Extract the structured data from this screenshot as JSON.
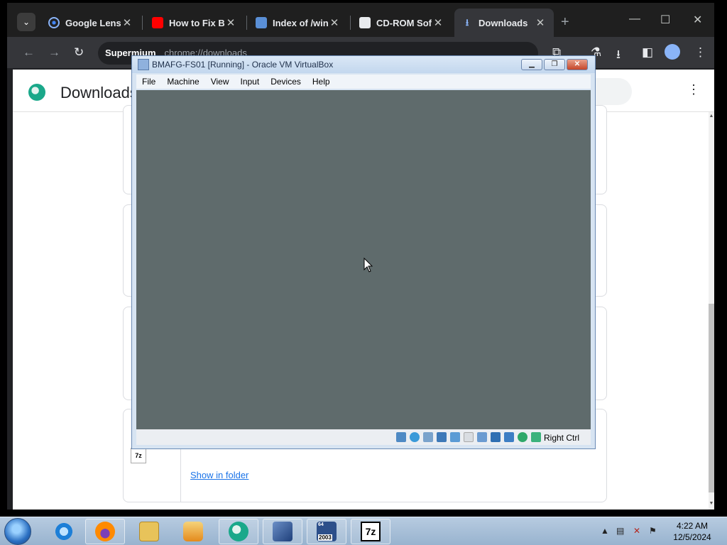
{
  "browser": {
    "tabs": [
      {
        "title": "Google Lens",
        "favicon": "google-lens-icon",
        "active": false
      },
      {
        "title": "How to Fix Bo",
        "favicon": "youtube-icon",
        "active": false
      },
      {
        "title": "Index of /win",
        "favicon": "document-icon",
        "active": false
      },
      {
        "title": "CD-ROM Soft",
        "favicon": "archive-icon",
        "active": false
      },
      {
        "title": "Downloads",
        "favicon": "download-icon",
        "active": true
      }
    ],
    "new_tab": "+",
    "omnibox": {
      "site": "Supermium",
      "url": "chrome://downloads"
    }
  },
  "downloads_page": {
    "title": "Downloads",
    "show_in_folder": "Show in folder",
    "file_icon_label": "7z"
  },
  "virtualbox": {
    "title": "BMAFG-FS01 [Running] - Oracle VM VirtualBox",
    "menu": [
      "File",
      "Machine",
      "View",
      "Input",
      "Devices",
      "Help"
    ],
    "host_key": "Right Ctrl",
    "screen_color": "#5f6b6c"
  },
  "taskbar": {
    "items": [
      "internet-explorer",
      "firefox",
      "file-explorer",
      "media-player",
      "supermium",
      "virtualbox",
      "windows-server-2003",
      "7-zip"
    ],
    "badge_2003": "2003",
    "badge_64": "64",
    "seven_zip_label": "7z",
    "time": "4:22 AM",
    "date": "12/5/2024"
  }
}
